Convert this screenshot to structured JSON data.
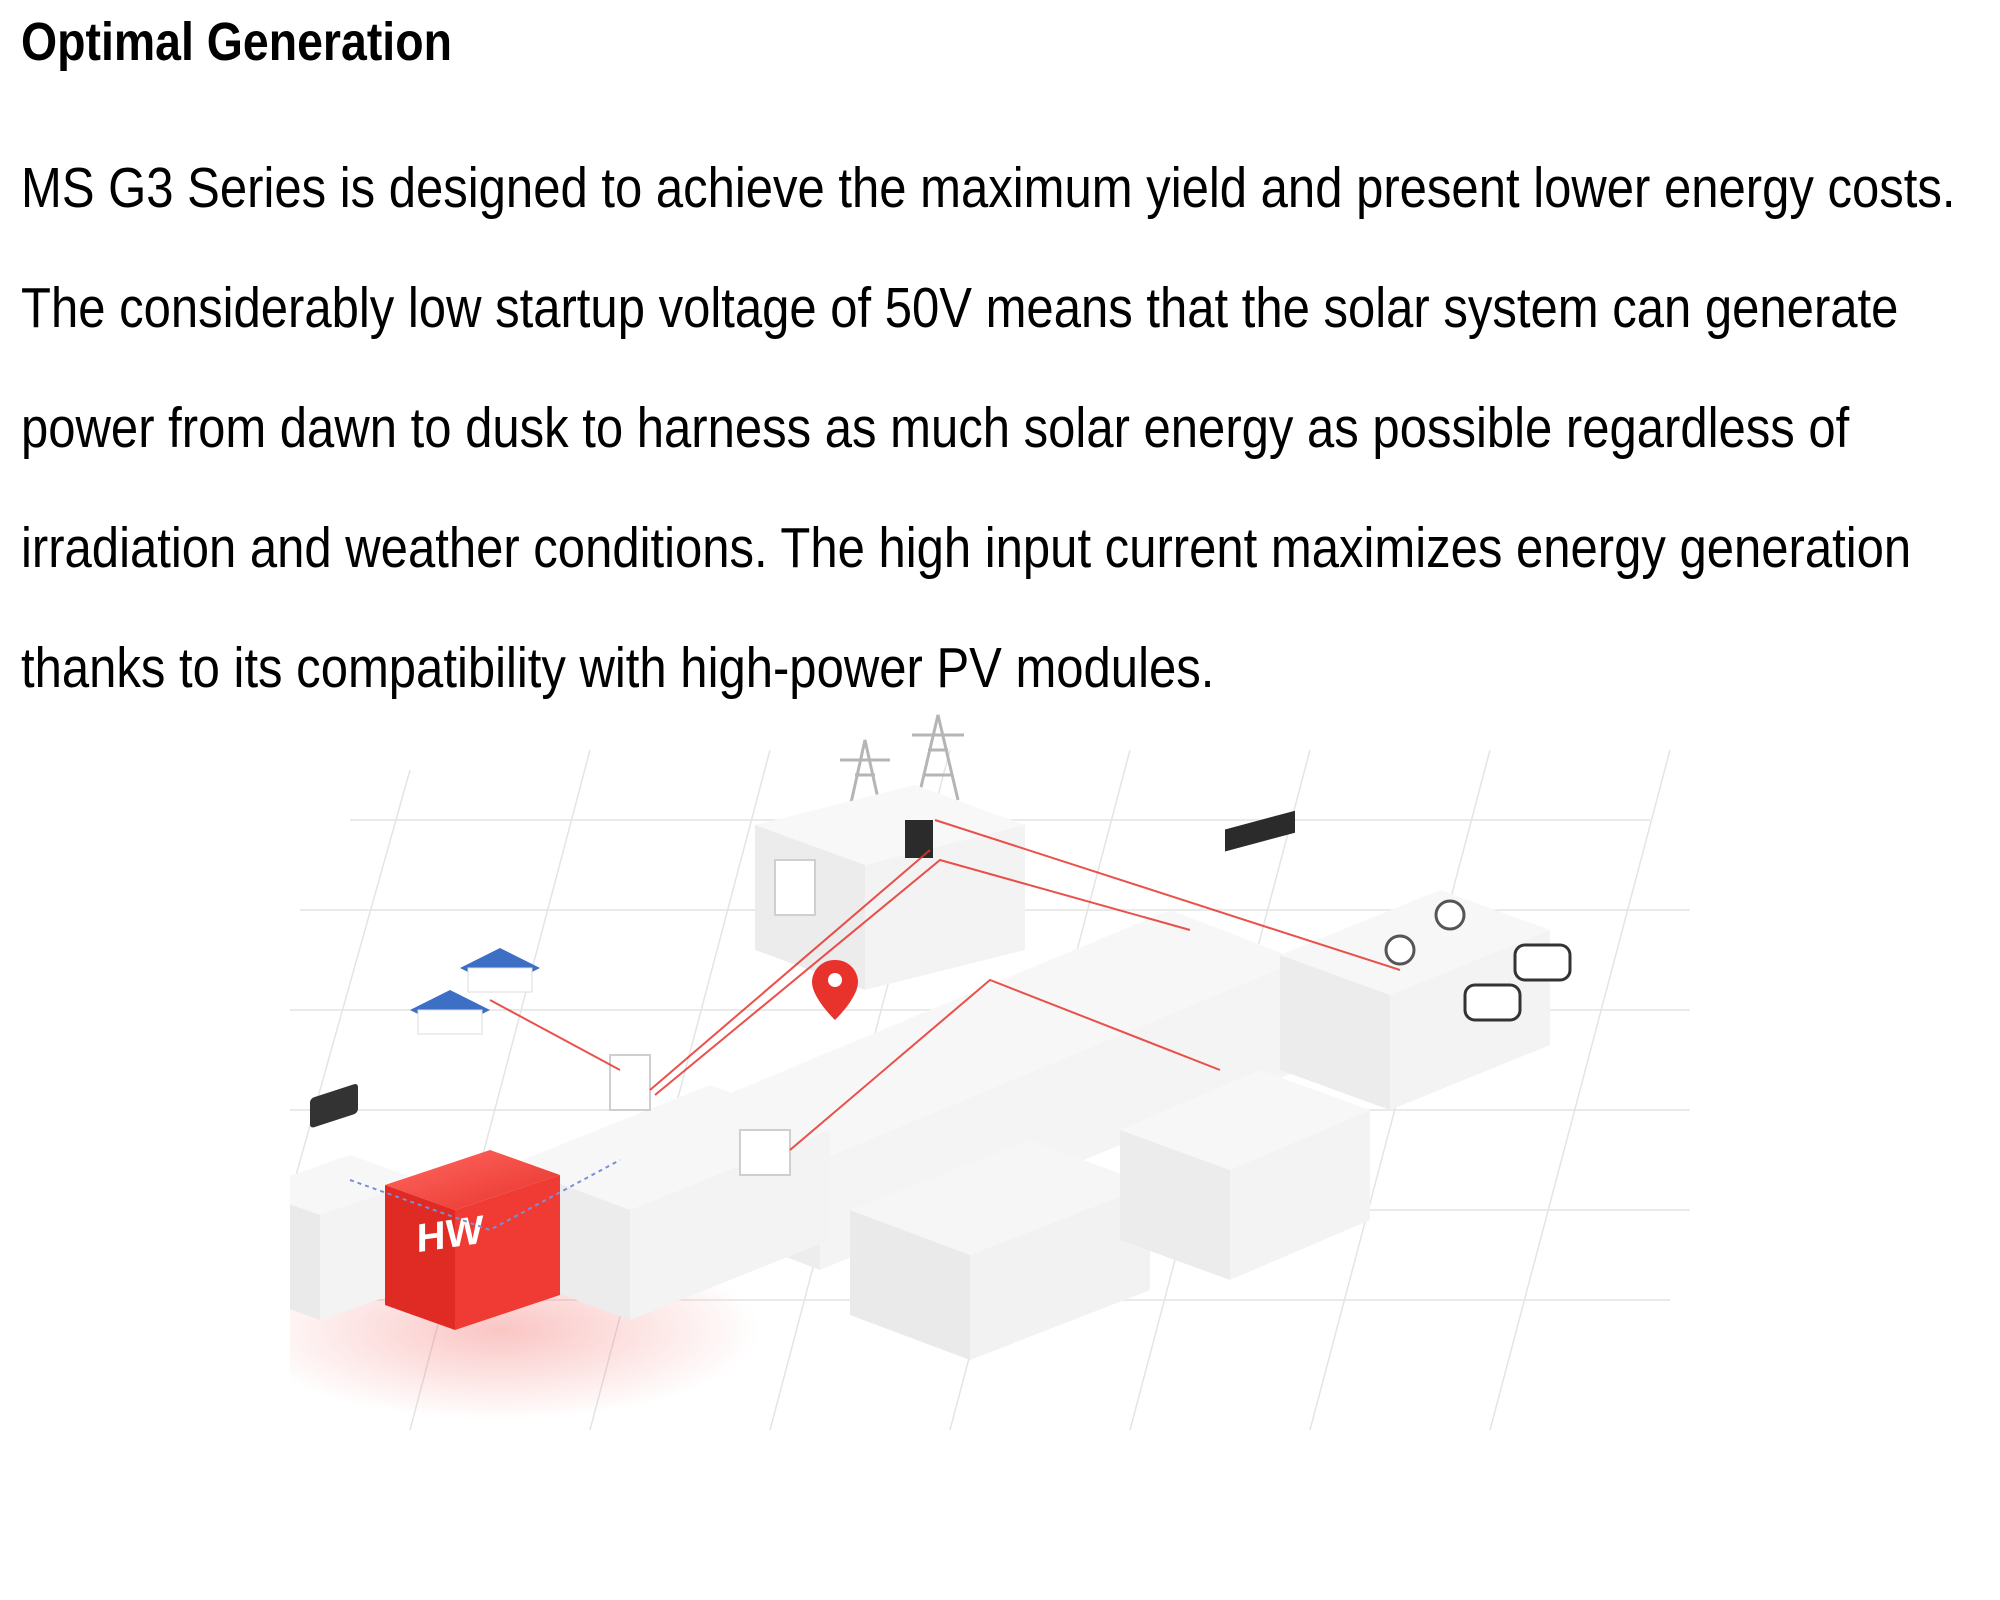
{
  "section": {
    "title": "Optimal Generation",
    "paragraph": "MS G3 Series is designed to achieve the maximum yield and present lower energy costs. The considerably low startup voltage of 50V means that the solar system can generate power from dawn to dusk to harness as much solar energy as possible regardless of irradiation and weather conditions. The high input current maximizes energy generation thanks to its compatibility with high-power PV modules."
  },
  "illustration": {
    "logo_text": "HW",
    "colors": {
      "accent": "#e8322c",
      "block": "#f2f1f1",
      "grid": "#e6e6e6",
      "solar_panel": "#3d6fc4"
    }
  }
}
